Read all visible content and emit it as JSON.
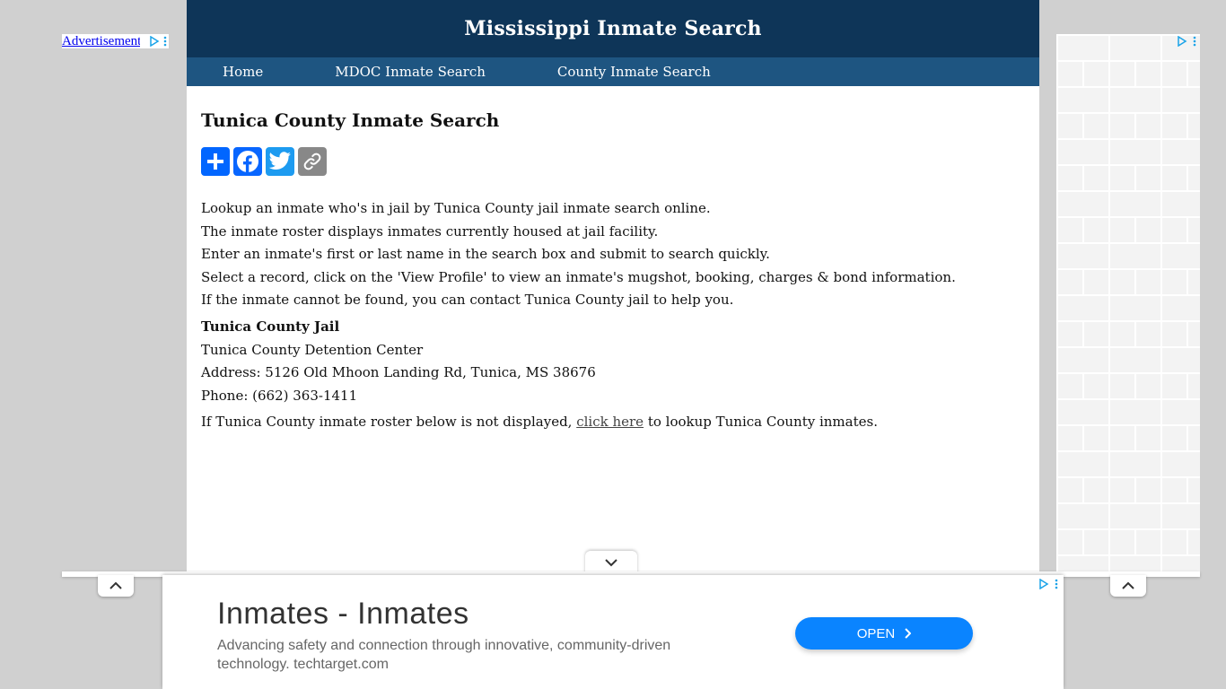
{
  "site": {
    "title": "Mississippi Inmate Search",
    "nav": [
      "Home",
      "MDOC Inmate Search",
      "County Inmate Search"
    ]
  },
  "left_ad": {
    "alt_text": "Advertisement"
  },
  "page": {
    "title": "Tunica County Inmate Search",
    "share_buttons": [
      "addtoany-icon",
      "facebook-icon",
      "twitter-icon",
      "copy-link-icon"
    ],
    "intro": [
      "Lookup an inmate who's in jail by Tunica County jail inmate search online.",
      "The inmate roster displays inmates currently housed at jail facility.",
      "Enter an inmate's first or last name in the search box and submit to search quickly.",
      "Select a record, click on the 'View Profile' to view an inmate's mugshot, booking, charges & bond information.",
      "If the inmate cannot be found, you can contact Tunica County jail to help you."
    ],
    "jail": {
      "name": "Tunica County Jail",
      "facility": "Tunica County Detention Center",
      "address": "Address: 5126 Old Mhoon Landing Rd, Tunica, MS 38676",
      "phone": "Phone: (662) 363-1411"
    },
    "note": {
      "before": "If Tunica County inmate roster below is not displayed, ",
      "link": "click here",
      "after": " to lookup Tunica County inmates."
    }
  },
  "bottom_ad": {
    "title": "Inmates - Inmates",
    "description": "Advancing safety and connection through innovative, community-driven technology. techtarget.com",
    "button": "OPEN"
  },
  "colors": {
    "header_bg": "#0e3558",
    "nav_bg": "#1e5581",
    "open_button": "#0a84ff"
  }
}
